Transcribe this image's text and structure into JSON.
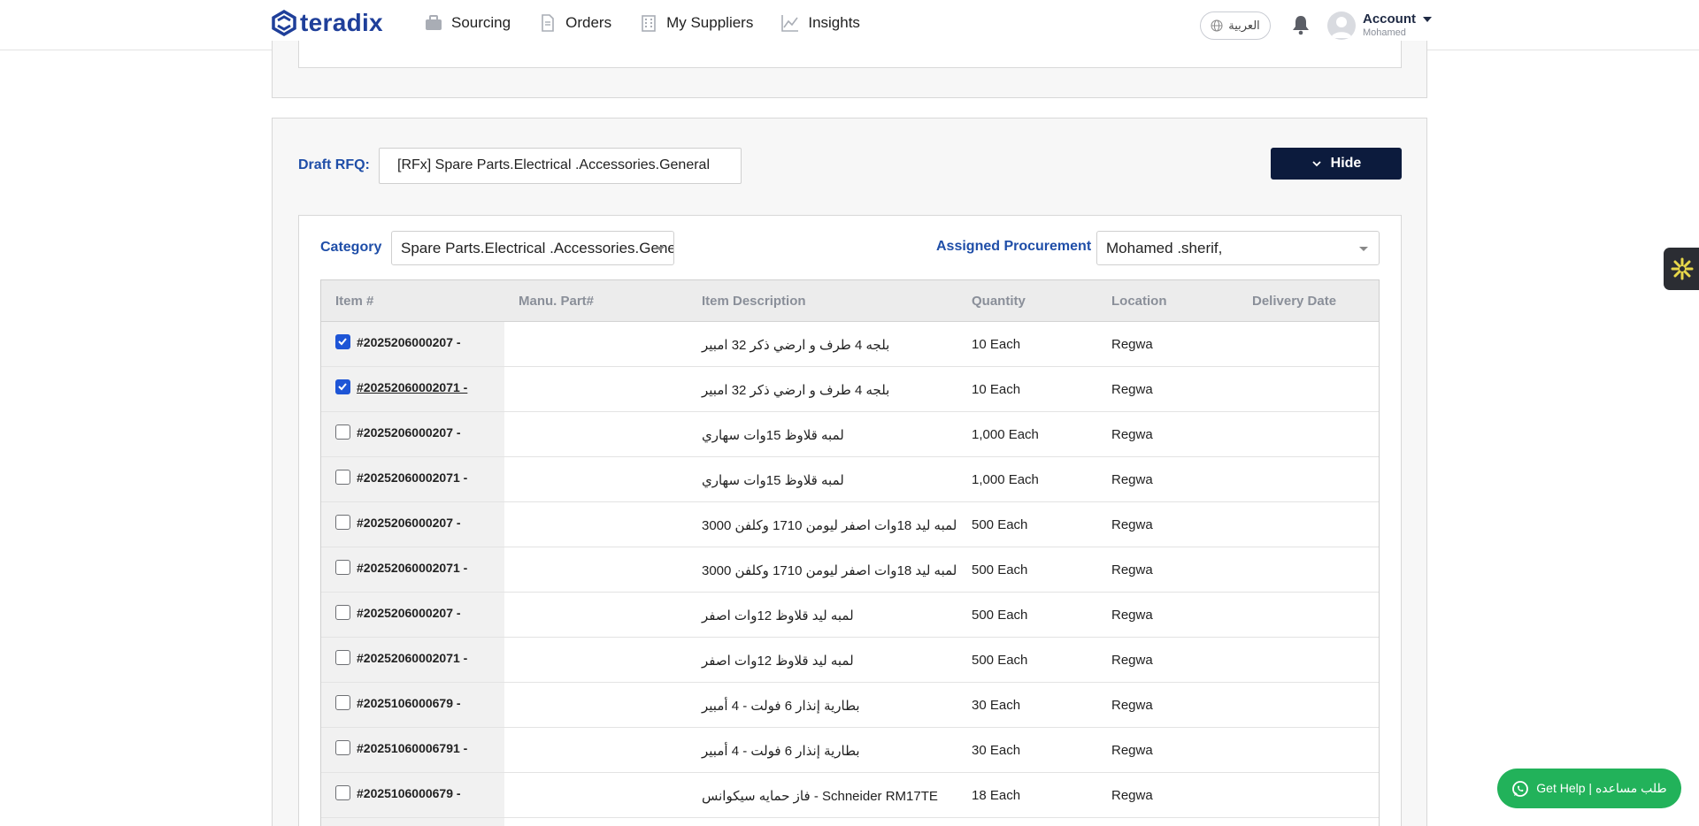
{
  "brand": {
    "name": "teradix",
    "color": "#1f3f9a"
  },
  "nav": {
    "items": [
      {
        "label": "Sourcing",
        "icon": "briefcase-icon"
      },
      {
        "label": "Orders",
        "icon": "document-icon"
      },
      {
        "label": "My Suppliers",
        "icon": "building-icon"
      },
      {
        "label": "Insights",
        "icon": "chart-icon"
      }
    ],
    "language_label": "العربية",
    "account_title": "Account",
    "account_user": "Mohamed"
  },
  "rfq": {
    "draft_label": "Draft RFQ:",
    "draft_value": "[RFx] Spare Parts.Electrical .Accessories.General",
    "hide_label": "Hide",
    "category_label": "Category",
    "category_value": "Spare Parts.Electrical .Accessories.General",
    "procurement_label": "Assigned Procurement",
    "procurement_value": "Mohamed .sherif,"
  },
  "table": {
    "columns": [
      "Item #",
      "Manu. Part#",
      "Item Description",
      "Quantity",
      "Location",
      "Delivery Date"
    ],
    "rows": [
      {
        "checked": true,
        "item": "#2025206000207 -",
        "part": "",
        "desc": "بلجه 4 طرف و ارضي ذكر 32 امبير",
        "qty": "10 Each",
        "loc": "Regwa",
        "date": ""
      },
      {
        "checked": true,
        "item": "#20252060002071 -",
        "part": "",
        "desc": "بلجه 4 طرف و ارضي ذكر 32 امبير",
        "qty": "10 Each",
        "loc": "Regwa",
        "date": ""
      },
      {
        "checked": false,
        "item": "#2025206000207 -",
        "part": "",
        "desc": "لمبه قلاوظ 15وات سهاري",
        "qty": "1,000 Each",
        "loc": "Regwa",
        "date": ""
      },
      {
        "checked": false,
        "item": "#20252060002071 -",
        "part": "",
        "desc": "لمبه قلاوظ 15وات سهاري",
        "qty": "1,000 Each",
        "loc": "Regwa",
        "date": ""
      },
      {
        "checked": false,
        "item": "#2025206000207 -",
        "part": "",
        "desc": "لمبه ليد 18وات اصفر ليومن 1710 وكلفن 3000",
        "qty": "500 Each",
        "loc": "Regwa",
        "date": ""
      },
      {
        "checked": false,
        "item": "#20252060002071 -",
        "part": "",
        "desc": "لمبه ليد 18وات اصفر ليومن 1710 وكلفن 3000",
        "qty": "500 Each",
        "loc": "Regwa",
        "date": ""
      },
      {
        "checked": false,
        "item": "#2025206000207 -",
        "part": "",
        "desc": "لمبه ليد قلاوظ 12وات اصفر",
        "qty": "500 Each",
        "loc": "Regwa",
        "date": ""
      },
      {
        "checked": false,
        "item": "#20252060002071 -",
        "part": "",
        "desc": "لمبه ليد قلاوظ 12وات اصفر",
        "qty": "500 Each",
        "loc": "Regwa",
        "date": ""
      },
      {
        "checked": false,
        "item": "#2025106000679 -",
        "part": "",
        "desc": "بطارية إنذار 6 فولت - 4 أمبير",
        "qty": "30 Each",
        "loc": "Regwa",
        "date": ""
      },
      {
        "checked": false,
        "item": "#20251060006791 -",
        "part": "",
        "desc": "بطارية إنذار 6 فولت - 4 أمبير",
        "qty": "30 Each",
        "loc": "Regwa",
        "date": ""
      },
      {
        "checked": false,
        "item": "#2025106000679 -",
        "part": "",
        "desc": "فاز حمايه سيكوانس - Schneider RM17TE",
        "qty": "18 Each",
        "loc": "Regwa",
        "date": ""
      }
    ]
  },
  "help": {
    "label": "Get Help | طلب مساعده",
    "color": "#22b25a"
  }
}
